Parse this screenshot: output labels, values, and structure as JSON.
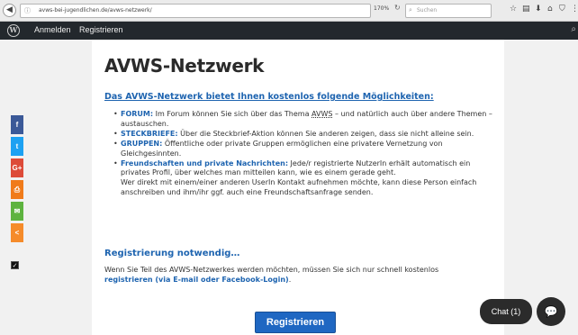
{
  "browser": {
    "url": "avws-bei-jugendlichen.de/avws-netzwerk/",
    "zoom": "170%",
    "search_placeholder": "Suchen"
  },
  "adminbar": {
    "login": "Anmelden",
    "register": "Registrieren"
  },
  "page": {
    "title": "AVWS-Netzwerk",
    "intro_heading": "Das AVWS-Netzwerk bietet Ihnen kostenlos folgende Möglichkeiten:",
    "features": [
      {
        "key": "FORUM:",
        "pre": " Im Forum können Sie sich über das Thema ",
        "abbr": "AVWS",
        "text": " – und natürlich auch über andere Themen – austauschen."
      },
      {
        "key": "STECKBRIEFE:",
        "text": " Über die Steckbrief-Aktion können Sie anderen zeigen, dass sie nicht alleine sein."
      },
      {
        "key": "GRUPPEN:",
        "text": " Öffentliche oder private Gruppen ermöglichen eine privatere Vernetzung von Gleichgesinnten."
      },
      {
        "key": "Freundschaften und private Nachrichten:",
        "text": " Jede/r registrierte NutzerIn erhält automatisch ein privates Profil, über welches man mitteilen kann, wie es einem gerade geht.",
        "extra": "Wer direkt mit einem/einer anderen UserIn Kontakt aufnehmen möchte, kann diese Person einfach anschreiben und ihm/ihr ggf. auch eine Freundschaftsanfrage senden."
      }
    ],
    "registration_heading": "Registrierung notwendig…",
    "registration_text_1": "Wenn Sie Teil des AVWS-Netzwerkes werden möchten, müssen Sie sich nur schnell kostenlos ",
    "registration_link": "registrieren (via E-mail oder Facebook-Login)",
    "registration_text_2": ".",
    "register_button": "Registrieren"
  },
  "share_buttons": [
    {
      "name": "facebook",
      "glyph": "f",
      "color": "#3b5998"
    },
    {
      "name": "twitter",
      "glyph": "t",
      "color": "#1da1f2"
    },
    {
      "name": "google-plus",
      "glyph": "G+",
      "color": "#dd4b39"
    },
    {
      "name": "print",
      "glyph": "⎙",
      "color": "#f07b1a"
    },
    {
      "name": "email",
      "glyph": "✉",
      "color": "#5eb33f"
    },
    {
      "name": "share",
      "glyph": "<",
      "color": "#f58b2a"
    }
  ],
  "chat": {
    "label": "Chat (1)"
  }
}
